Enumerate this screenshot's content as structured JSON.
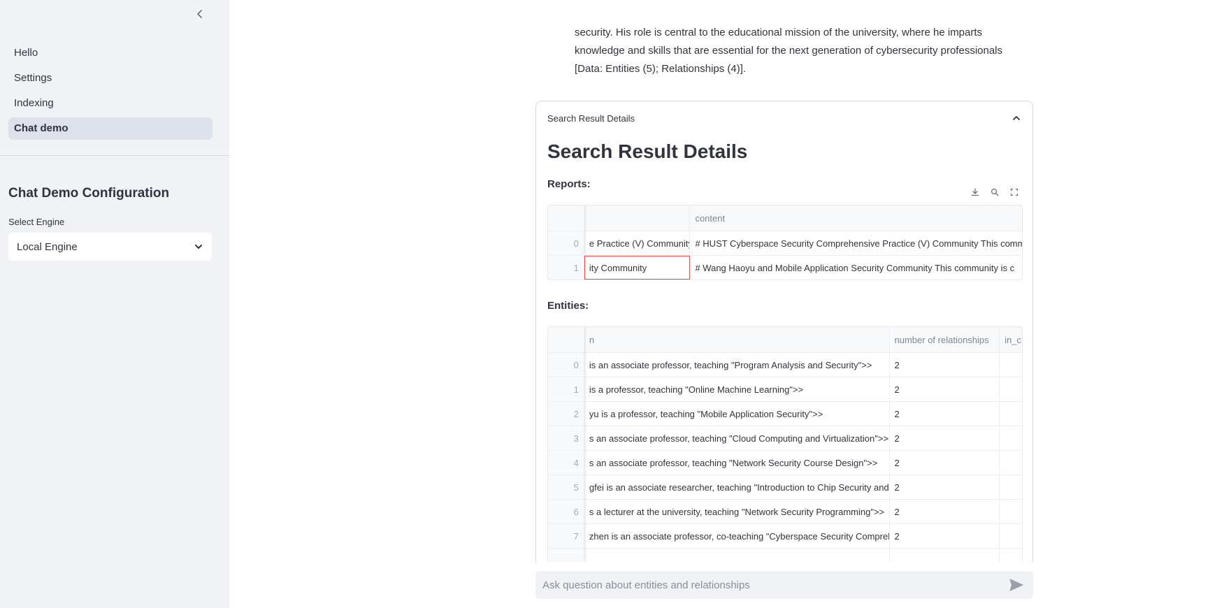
{
  "sidebar": {
    "nav_items": [
      {
        "label": "Hello"
      },
      {
        "label": "Settings"
      },
      {
        "label": "Indexing"
      },
      {
        "label": "Chat demo",
        "active": true
      }
    ],
    "config_title": "Chat Demo Configuration",
    "select_label": "Select Engine",
    "select_value": "Local Engine"
  },
  "answer": {
    "text_lines": [
      "security. His role is central to the educational mission of the university, where he imparts",
      "knowledge and skills that are essential for the next generation of cybersecurity professionals",
      "[Data: Entities (5); Relationships (4)]."
    ]
  },
  "expander": {
    "header_label": "Search Result Details",
    "title": "Search Result Details",
    "reports_label": "Reports:",
    "entities_label": "Entities:"
  },
  "reports_table": {
    "columns": [
      "",
      "content"
    ],
    "rows": [
      {
        "index": "0",
        "title": "e Practice (V) Community",
        "content": "# HUST Cyberspace Security Comprehensive Practice (V) Community  This comm"
      },
      {
        "index": "1",
        "title": "ity Community",
        "content": "# Wang Haoyu and Mobile Application Security Community  This community is c"
      }
    ]
  },
  "entities_table": {
    "columns": [
      "n",
      "number of relationships",
      "in_c"
    ],
    "rows": [
      {
        "index": "0",
        "description": "is an associate professor, teaching \"Program Analysis and Security\">>",
        "relationships": "2"
      },
      {
        "index": "1",
        "description": "is a professor, teaching \"Online Machine Learning\">>",
        "relationships": "2"
      },
      {
        "index": "2",
        "description": "yu is a professor, teaching \"Mobile Application Security\">>",
        "relationships": "2"
      },
      {
        "index": "3",
        "description": "s an associate professor, teaching \"Cloud Computing and Virtualization\">>",
        "relationships": "2"
      },
      {
        "index": "4",
        "description": "s an associate professor, teaching \"Network Security Course Design\">>",
        "relationships": "2"
      },
      {
        "index": "5",
        "description": "gfei is an associate researcher, teaching \"Introduction to Chip Security and",
        "relationships": "2"
      },
      {
        "index": "6",
        "description": "s a lecturer at the university, teaching \"Network Security Programming\">>",
        "relationships": "2"
      },
      {
        "index": "7",
        "description": "zhen is an associate professor, co-teaching \"Cyberspace Security Comprehe",
        "relationships": "2"
      }
    ]
  },
  "chat": {
    "placeholder": "Ask question about entities and relationships"
  },
  "icons": {
    "collapse": "chevron-left-icon",
    "select": "chevron-down-icon",
    "expander": "chevron-up-icon",
    "download": "download-icon",
    "search": "search-icon",
    "fullscreen": "fullscreen-icon",
    "send": "send-icon"
  },
  "colors": {
    "sidebar_bg": "#f0f2f6",
    "active_nav_bg": "#dde1ea",
    "selected_cell_border": "#ff4b4b",
    "text": "#31333f"
  }
}
